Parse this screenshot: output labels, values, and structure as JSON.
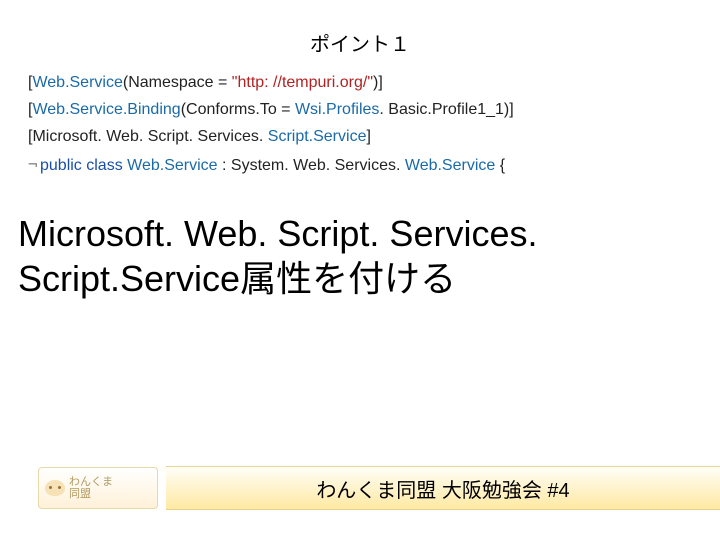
{
  "title": "ポイント１",
  "code": {
    "line1": {
      "a": "[",
      "b": "Web.Service",
      "c": "(Namespace = ",
      "d": "\"http: //tempuri.org/\"",
      "e": ")]"
    },
    "line2": {
      "a": "[",
      "b": "Web.Service.Binding",
      "c": "(Conforms.To = ",
      "d": "Wsi.Profiles",
      "e": ". Basic.Profile1_1)]"
    },
    "line3": {
      "a": "[Microsoft. Web. Script. Services. ",
      "b": "Script.Service",
      "c": "]"
    },
    "line4": {
      "mark": "¬",
      "a": "public class ",
      "b": "Web.Service",
      "c": " : System. Web. Services. ",
      "d": "Web.Service",
      "e": " {"
    }
  },
  "headline_l1": "Microsoft. Web. Script. Services.",
  "headline_l2": "Script.Service属性を付ける",
  "logo": {
    "line1": "わんくま",
    "line2": "同盟"
  },
  "footer": "わんくま同盟 大阪勉強会 #4"
}
